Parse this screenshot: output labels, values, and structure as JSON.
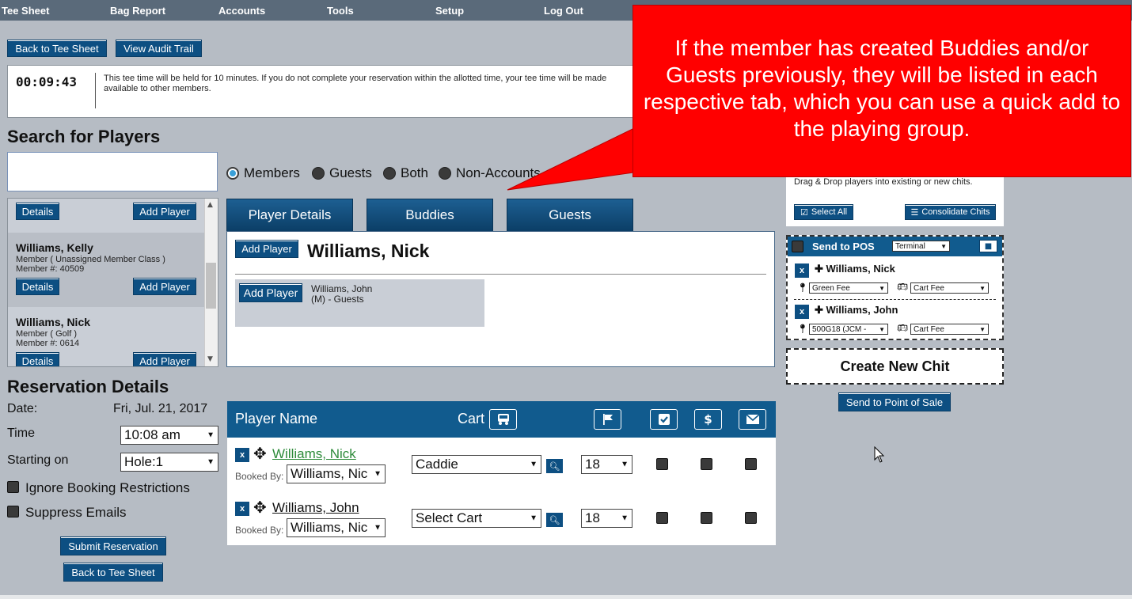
{
  "nav": [
    "Tee Sheet",
    "Bag Report",
    "Accounts",
    "Tools",
    "Setup",
    "Log Out"
  ],
  "top_buttons": {
    "back": "Back to Tee Sheet",
    "audit": "View Audit Trail"
  },
  "timer": {
    "value": "00:09:43",
    "message": "This tee time will be held for 10 minutes. If you do not complete your reservation within the allotted time, your tee time will be made available to other members."
  },
  "search": {
    "title": "Search for Players",
    "placeholder": ""
  },
  "filters": [
    {
      "label": "Members",
      "selected": true
    },
    {
      "label": "Guests",
      "selected": false
    },
    {
      "label": "Both",
      "selected": false
    },
    {
      "label": "Non-Accounts",
      "selected": false
    }
  ],
  "player_list": {
    "details_label": "Details",
    "add_label": "Add Player",
    "items": [
      {
        "name": "Williams, Kelly",
        "meta1": "Member ( Unassigned Member Class )",
        "meta2": "Member #: 40509"
      },
      {
        "name": "Williams, Nick",
        "meta1": "Member ( Golf )",
        "meta2": "Member #: 0614"
      }
    ]
  },
  "tabs": [
    "Player Details",
    "Buddies",
    "Guests"
  ],
  "detail": {
    "add_label": "Add Player",
    "name": "Williams, Nick",
    "buddy": {
      "add_label": "Add Player",
      "name": "Williams, John",
      "type": "(M) - Guests"
    }
  },
  "reservation": {
    "title": "Reservation Details",
    "date_label": "Date:",
    "date_value": "Fri, Jul. 21, 2017",
    "time_label": "Time",
    "time_value": "10:08 am",
    "start_label": "Starting on",
    "start_value": "Hole:1",
    "ignore_label": "Ignore Booking Restrictions",
    "suppress_label": "Suppress Emails",
    "submit": "Submit Reservation",
    "back": "Back to Tee Sheet"
  },
  "grid": {
    "header_name": "Player Name",
    "header_cart": "Cart",
    "icons": [
      "cart-icon",
      "flag-icon",
      "check-icon",
      "dollar-icon",
      "envelope-icon"
    ],
    "booked_label": "Booked By:",
    "rows": [
      {
        "x": "x",
        "name": "Williams, Nick",
        "booked_by": "Williams, Nic",
        "cart": "Caddie",
        "holes": "18",
        "name_color": "#2e8b3a"
      },
      {
        "x": "x",
        "name": "Williams, John",
        "booked_by": "Williams, Nic",
        "cart": "Select Cart",
        "holes": "18",
        "name_color": "#111111"
      }
    ]
  },
  "callout": {
    "text": "If the member has created Buddies and/or Guests previously, they will be listed in each respective tab, which you can use a quick add to the playing group.",
    "color": "#ff0000"
  },
  "right_panel": {
    "drag_text": "Drag & Drop players into existing or new chits.",
    "select_all": "Select All",
    "consolidate": "Consolidate Chits",
    "pos_title": "Send to POS",
    "pos_select": "Terminal",
    "pos_players": [
      {
        "name": "Williams, Nick",
        "fee": "Green Fee",
        "cart": "Cart Fee"
      },
      {
        "name": "Williams, John",
        "fee": "500G18 (JCM -",
        "cart": "Cart Fee"
      }
    ],
    "new_chit": "Create New Chit",
    "send_pos": "Send to Point of Sale"
  }
}
